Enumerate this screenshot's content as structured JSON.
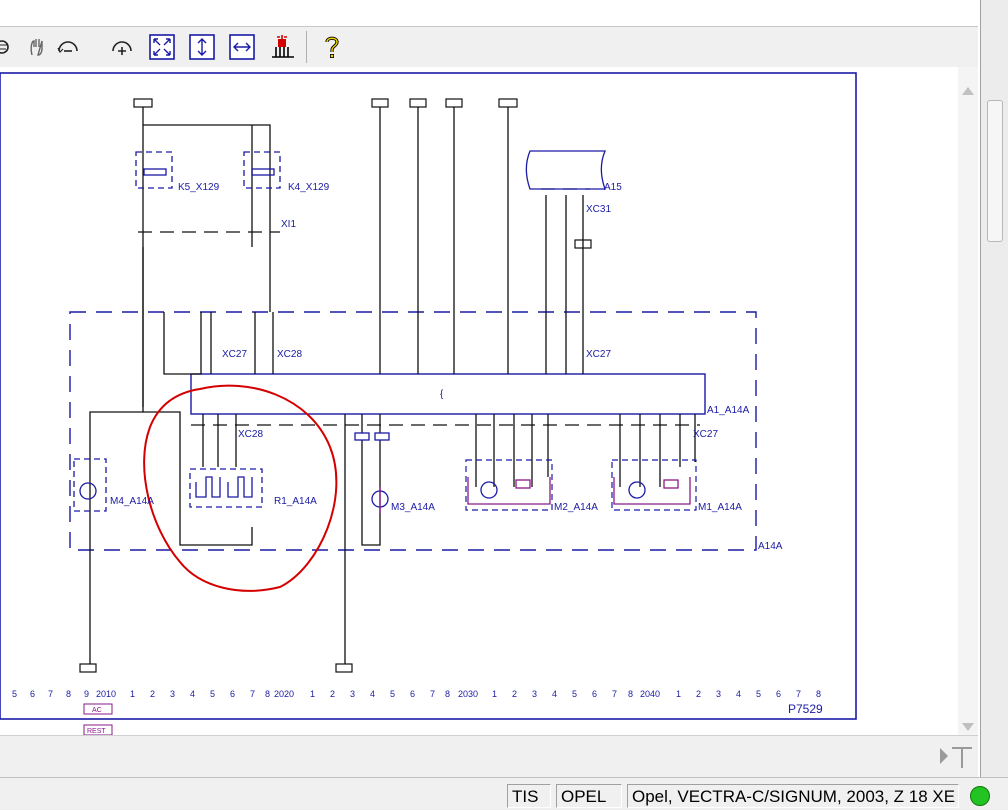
{
  "toolbar": {
    "icons": [
      "zoom-window-icon",
      "pan-icon",
      "zoom-out-icon",
      "zoom-in-icon",
      "fit-all-icon",
      "fit-height-icon",
      "fit-width-icon",
      "highlight-signal-icon",
      "help-icon"
    ]
  },
  "diagram": {
    "components": {
      "k5": "K5_X129",
      "k4": "K4_X129",
      "xi1": "XI1",
      "a15": "A15",
      "xc31": "XC31",
      "xc27_left": "XC27",
      "xc28_top": "XC28",
      "xc27_right": "XC27",
      "a1": "A1_A14A",
      "xc28_low": "XC28",
      "xc27_low": "XC27",
      "m4": "M4_A14A",
      "r1": "R1_A14A",
      "m3": "M3_A14A",
      "m2": "M2_A14A",
      "m1": "M1_A14A",
      "a14a": "A14A"
    },
    "ruler": {
      "n2010": "2010",
      "n2020": "2020",
      "n2030": "2030",
      "n2040": "2040",
      "page_id": "P7529"
    },
    "tags": {
      "ac": "AC",
      "rest": "REST"
    },
    "colors": {
      "wire": "#1a1aa6",
      "frame": "#1a1aa6",
      "black": "#101010",
      "annotation": "#d40000",
      "tag": "#8a1a8a"
    }
  },
  "status": {
    "tis": "TIS",
    "brand": "OPEL",
    "vehicle": "Opel, VECTRA-C/SIGNUM, 2003, Z 18 XE",
    "connection_color": "#22c322"
  }
}
